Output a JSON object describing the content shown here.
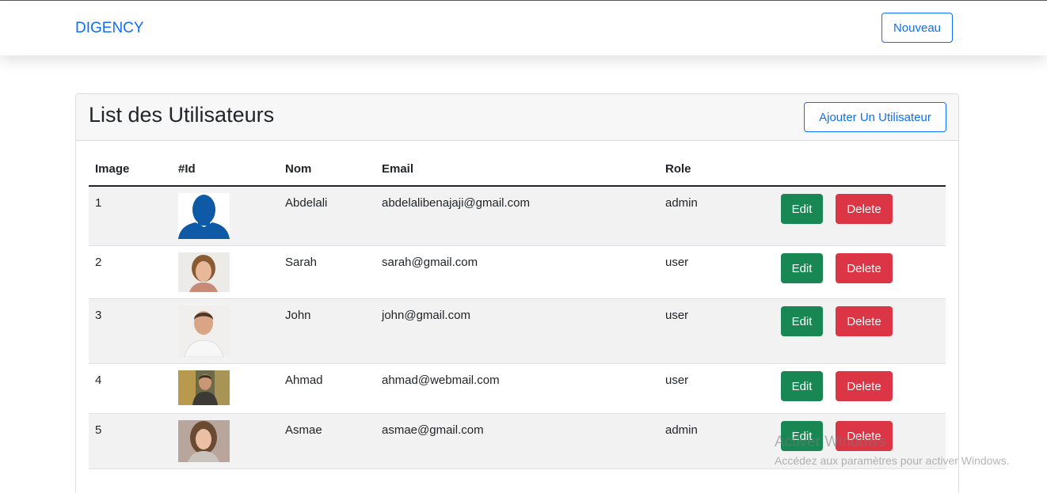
{
  "navbar": {
    "brand": "DIGENCY",
    "new_button": "Nouveau"
  },
  "card": {
    "title": "List des Utilisateurs",
    "add_button": "Ajouter Un Utilisateur"
  },
  "table": {
    "headers": [
      "Image",
      "#Id",
      "Nom",
      "Email",
      "Role"
    ],
    "rows": [
      {
        "id": "1",
        "name": "Abdelali",
        "email": "abdelalibenajaji@gmail.com",
        "role": "admin",
        "edit": "Edit",
        "delete": "Delete",
        "image": "default-silhouette-avatar"
      },
      {
        "id": "2",
        "name": "Sarah",
        "email": "sarah@gmail.com",
        "role": "user",
        "edit": "Edit",
        "delete": "Delete",
        "image": "woman-photo"
      },
      {
        "id": "3",
        "name": "John",
        "email": "john@gmail.com",
        "role": "user",
        "edit": "Edit",
        "delete": "Delete",
        "image": "man-photo"
      },
      {
        "id": "4",
        "name": "Ahmad",
        "email": "ahmad@webmail.com",
        "role": "user",
        "edit": "Edit",
        "delete": "Delete",
        "image": "man-outdoor-photo"
      },
      {
        "id": "5",
        "name": "Asmae",
        "email": "asmae@gmail.com",
        "role": "admin",
        "edit": "Edit",
        "delete": "Delete",
        "image": "woman-photo"
      }
    ]
  },
  "watermark": {
    "line1": "Activer Windows",
    "line2": "Accédez aux paramètres pour activer Windows."
  },
  "colors": {
    "primary": "#0d6efd",
    "edit": "#198754",
    "delete": "#dc3545"
  }
}
